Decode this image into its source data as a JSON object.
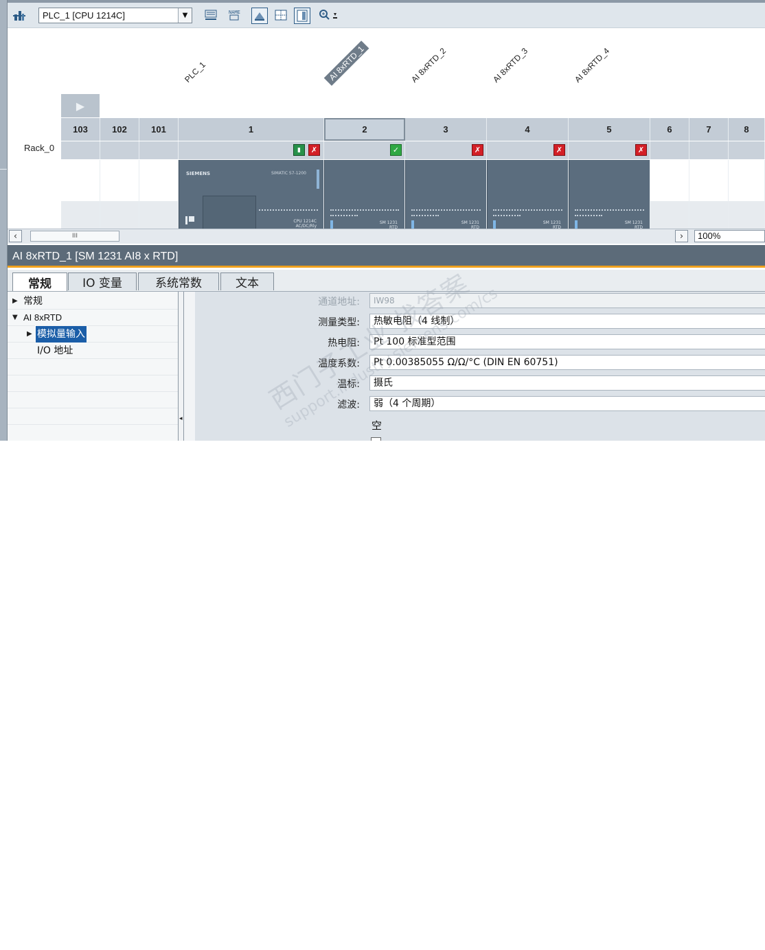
{
  "toolbar": {
    "device_select_value": "PLC_1 [CPU 1214C]",
    "icons": [
      "network-icon",
      "dropdown-arrow-icon",
      "address-overview-icon",
      "device-name-icon",
      "module-labels-icon",
      "grid-icon",
      "page-break-icon",
      "zoom-icon"
    ]
  },
  "device_view": {
    "column_labels": [
      "PLC_1",
      "AI 8xRTD_1",
      "AI 8xRTD_2",
      "AI 8xRTD_3",
      "AI 8xRTD_4"
    ],
    "slots": [
      "103",
      "102",
      "101",
      "1",
      "2",
      "3",
      "4",
      "5",
      "6",
      "7",
      "8"
    ],
    "rack_label": "Rack_0",
    "selected_slot": "2",
    "cpu_brand": "SIEMENS",
    "cpu_model": "SIMATIC S7-1200",
    "cpu_small": "CPU 1214C",
    "cpu_small2": "AC/DC/Rly",
    "sm_small": "SM 1231",
    "sm_small2": "RTD"
  },
  "scrollbar": {
    "thumb_label": "III",
    "zoom_value": "100%"
  },
  "inspector": {
    "title": "AI 8xRTD_1 [SM 1231 AI8 x RTD]",
    "tabs": [
      "常规",
      "IO 变量",
      "系统常数",
      "文本"
    ],
    "active_tab": "常规",
    "nav": {
      "general": "常规",
      "module": "AI 8xRTD",
      "analog_input": "模拟量输入",
      "io_address": "I/O 地址"
    },
    "properties": {
      "channel_address_label": "通道地址:",
      "channel_address_value": "IW98",
      "measurement_type_label": "测量类型:",
      "measurement_type_value": "热敏电阻（4 线制）",
      "rtd_label": "热电阻:",
      "rtd_value": "Pt 100 标准型范围",
      "temp_coeff_label": "温度系数:",
      "temp_coeff_value": "Pt 0.00385055 Ω/Ω/°C (DIN EN 60751)",
      "temp_scale_label": "温标:",
      "temp_scale_value": "摄氏",
      "filter_label": "滤波:",
      "filter_value": "弱（4 个周期）",
      "empty_text": "空"
    }
  },
  "watermark": {
    "line1": "西门子工业  找答案",
    "line2": "support.industry.siemens.com/cs"
  }
}
